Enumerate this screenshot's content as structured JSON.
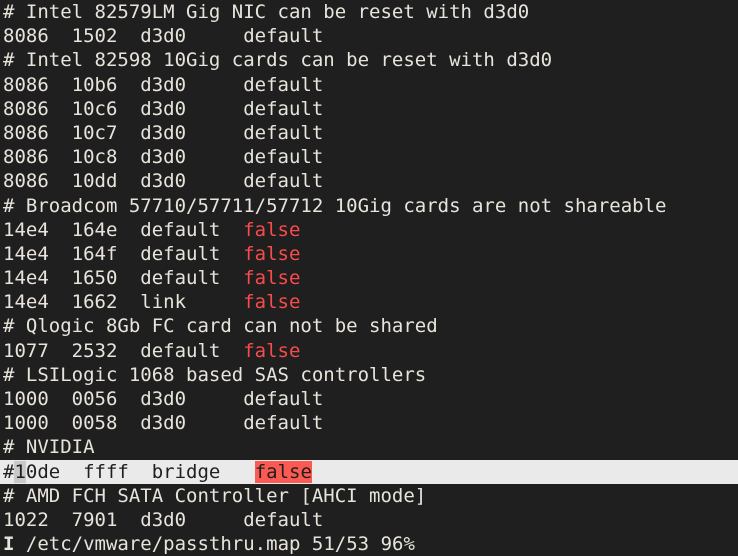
{
  "terminal": {
    "background_color": "#1f1f1f",
    "foreground_color": "#e8e4dc",
    "false_color": "#f84b4b",
    "selection_background": "#eaeaea",
    "selection_false_background": "#fb5a53",
    "cursor_background": "#c9c9c9",
    "columns": 52,
    "rows": 23
  },
  "lines": [
    {
      "kind": "comment",
      "text": "# Intel 82579LM Gig NIC can be reset with d3d0"
    },
    {
      "kind": "entry",
      "prefix": "8086  1502  d3d0     default",
      "value": ""
    },
    {
      "kind": "comment",
      "text": "# Intel 82598 10Gig cards can be reset with d3d0"
    },
    {
      "kind": "entry",
      "prefix": "8086  10b6  d3d0     default",
      "value": ""
    },
    {
      "kind": "entry",
      "prefix": "8086  10c6  d3d0     default",
      "value": ""
    },
    {
      "kind": "entry",
      "prefix": "8086  10c7  d3d0     default",
      "value": ""
    },
    {
      "kind": "entry",
      "prefix": "8086  10c8  d3d0     default",
      "value": ""
    },
    {
      "kind": "entry",
      "prefix": "8086  10dd  d3d0     default",
      "value": ""
    },
    {
      "kind": "comment",
      "text": "# Broadcom 57710/57711/57712 10Gig cards are not shareable"
    },
    {
      "kind": "entry",
      "prefix": "14e4  164e  default  ",
      "value": "false"
    },
    {
      "kind": "entry",
      "prefix": "14e4  164f  default  ",
      "value": "false"
    },
    {
      "kind": "entry",
      "prefix": "14e4  1650  default  ",
      "value": "false"
    },
    {
      "kind": "entry",
      "prefix": "14e4  1662  link     ",
      "value": "false"
    },
    {
      "kind": "comment",
      "text": "# Qlogic 8Gb FC card can not be shared"
    },
    {
      "kind": "entry",
      "prefix": "1077  2532  default  ",
      "value": "false"
    },
    {
      "kind": "comment",
      "text": "# LSILogic 1068 based SAS controllers"
    },
    {
      "kind": "entry",
      "prefix": "1000  0056  d3d0     default",
      "value": ""
    },
    {
      "kind": "entry",
      "prefix": "1000  0058  d3d0     default",
      "value": ""
    },
    {
      "kind": "comment",
      "text": "# NVIDIA"
    },
    {
      "kind": "selected",
      "cursor_before": "#",
      "cursor_char": "1",
      "prefix": "0de  ffff  bridge   ",
      "value": "false"
    },
    {
      "kind": "comment",
      "text": "# AMD FCH SATA Controller [AHCI mode]"
    },
    {
      "kind": "entry",
      "prefix": "1022  7901  d3d0     default",
      "value": ""
    }
  ],
  "statusbar": {
    "flag": "I",
    "filename": "/etc/vmware/passthru.map",
    "position": "51/53",
    "percent": "96%",
    "full_text": "I /etc/vmware/passthru.map 51/53 96%"
  }
}
